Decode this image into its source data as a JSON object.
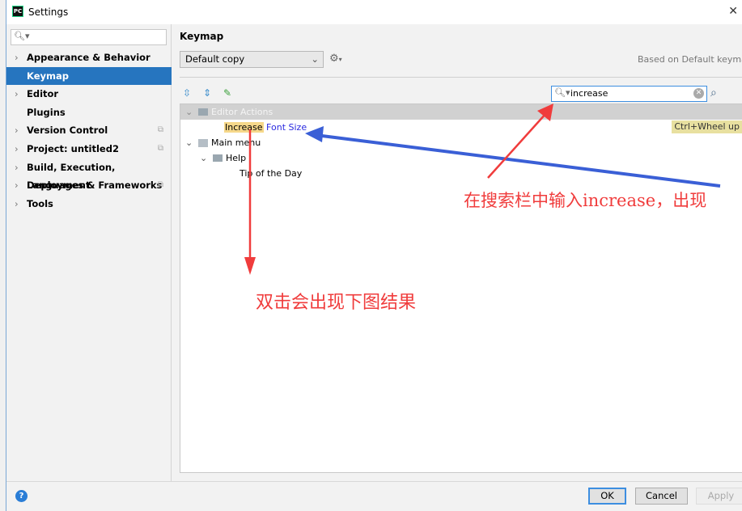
{
  "window": {
    "title": "Settings",
    "app_icon": "PC"
  },
  "sidebar": {
    "search_placeholder": "",
    "items": [
      {
        "label": "Appearance & Behavior",
        "expandable": true
      },
      {
        "label": "Keymap",
        "selected": true
      },
      {
        "label": "Editor",
        "expandable": true
      },
      {
        "label": "Plugins"
      },
      {
        "label": "Version Control",
        "expandable": true,
        "project": true
      },
      {
        "label": "Project: untitled2",
        "expandable": true,
        "project": true
      },
      {
        "label": "Build, Execution, Deployment",
        "expandable": true
      },
      {
        "label": "Languages & Frameworks",
        "expandable": true,
        "project": true
      },
      {
        "label": "Tools",
        "expandable": true
      }
    ]
  },
  "main": {
    "title": "Keymap",
    "keymap_select": "Default copy",
    "based_on": "Based on Default keymap",
    "search_value": "increase",
    "tree": {
      "group": "Editor Actions",
      "action_highlight": "Increase",
      "action_rest": " Font Size",
      "shortcut": "Ctrl+Wheel up",
      "main_menu": "Main menu",
      "help": "Help",
      "tip": "Tip of the Day"
    }
  },
  "footer": {
    "ok": "OK",
    "cancel": "Cancel",
    "apply": "Apply"
  },
  "annotations": {
    "search_note": "在搜索栏中输入increase，出现",
    "double_click_note": "双击会出现下图结果",
    "red": "#f03c3c",
    "blue": "#3a5fd6"
  },
  "colors": {
    "selection": "#2675bf",
    "highlight": "#f6d88a"
  }
}
